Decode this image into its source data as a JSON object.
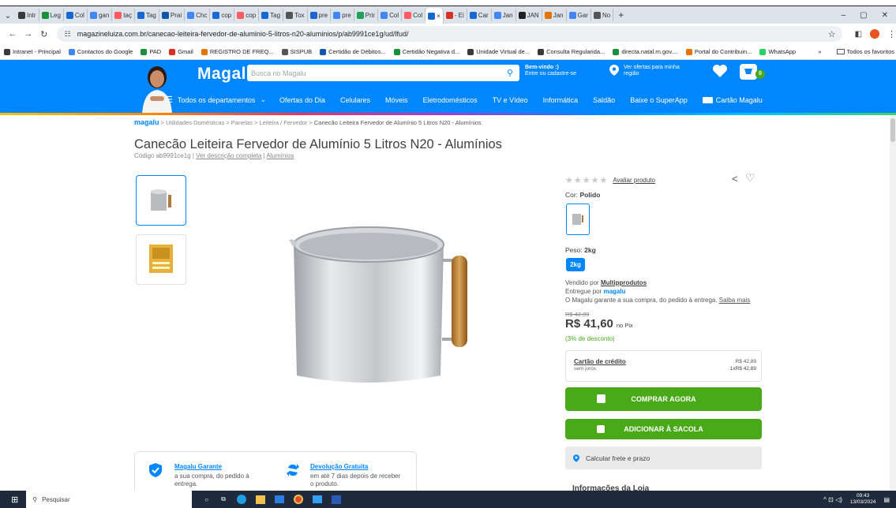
{
  "browser": {
    "tabs": [
      {
        "label": "Intr",
        "color": "#3a3a3a"
      },
      {
        "label": "Leg",
        "color": "#1a8f3c"
      },
      {
        "label": "Col",
        "color": "#1967d2"
      },
      {
        "label": "gan",
        "color": "#4285f4"
      },
      {
        "label": "taç",
        "color": "#ff5a5f"
      },
      {
        "label": "Tag",
        "color": "#1967d2"
      },
      {
        "label": "Prai",
        "color": "#1256a8"
      },
      {
        "label": "Chc",
        "color": "#4285f4"
      },
      {
        "label": "cop",
        "color": "#1967d2"
      },
      {
        "label": "cop",
        "color": "#ff5a5f"
      },
      {
        "label": "Tag",
        "color": "#1967d2"
      },
      {
        "label": "Tox",
        "color": "#555555"
      },
      {
        "label": "pre",
        "color": "#1967d2"
      },
      {
        "label": "pre",
        "color": "#4285f4"
      },
      {
        "label": "Prir",
        "color": "#20a05a"
      },
      {
        "label": "Col",
        "color": "#4285f4"
      },
      {
        "label": "Col",
        "color": "#ff5a5f"
      },
      {
        "label": "×",
        "color": "#1967d2",
        "active": true
      },
      {
        "label": "- Ei",
        "color": "#d93025"
      },
      {
        "label": "Car",
        "color": "#1967d2"
      },
      {
        "label": "Jan",
        "color": "#4285f4"
      },
      {
        "label": "JAN",
        "color": "#222222"
      },
      {
        "label": "Jan",
        "color": "#e37400"
      },
      {
        "label": "Gar",
        "color": "#4285f4"
      },
      {
        "label": "No",
        "color": "#555555"
      }
    ],
    "new_tab": "+",
    "window_controls": {
      "minimize": "–",
      "restore": "▢",
      "close": "✕"
    },
    "url": "magazineluiza.com.br/canecao-leiteira-fervedor-de-aluminio-5-litros-n20-aluminios/p/ab9991ce1g/ud/lfud/",
    "bookmarks": [
      {
        "label": "Intranet - Principal",
        "color": "#3a3a3a"
      },
      {
        "label": "Contactos do Google",
        "color": "#4285f4"
      },
      {
        "label": "PAD",
        "color": "#1a8f3c"
      },
      {
        "label": "Gmail",
        "color": "#d93025"
      },
      {
        "label": "REGISTRO DE FREQ...",
        "color": "#e37400"
      },
      {
        "label": "SISPUB",
        "color": "#555555"
      },
      {
        "label": "Certidão de Débitos...",
        "color": "#1256a8"
      },
      {
        "label": "Certidão Negativa d...",
        "color": "#1a8f3c"
      },
      {
        "label": "Unidade Virtual de...",
        "color": "#3a3a3a"
      },
      {
        "label": "Consulta Regularida...",
        "color": "#3a3a3a"
      },
      {
        "label": "directa.natal.rn.gov....",
        "color": "#1a8f3c"
      },
      {
        "label": "Portal do Contribuin...",
        "color": "#e37400"
      },
      {
        "label": "WhatsApp",
        "color": "#25d366"
      }
    ],
    "bookmarks_more": "»",
    "all_bookmarks": "Todos os favoritos"
  },
  "header": {
    "logo": "Magalu",
    "search_placeholder": "Busca no Magalu",
    "welcome_line1": "Bem-vindo :)",
    "welcome_line2": "Entre ou cadastre-se",
    "offers_line1": "Ver ofertas para minha",
    "offers_line2": "região",
    "cart_count": "0",
    "menu": [
      "Todos os departamentos",
      "Ofertas do Dia",
      "Celulares",
      "Móveis",
      "Eletrodomésticos",
      "TV e Vídeo",
      "Informática",
      "Saldão",
      "Baixe o SuperApp",
      "Cartão Magalu"
    ],
    "accent": "#0086ff"
  },
  "breadcrumb": {
    "logo": "magalu",
    "path": " > Utilidades Domésticas > Panelas > Leiteira / Fervedor > ",
    "current": "Canecão Leiteira Fervedor de Alumínio 5 Litros N20 - Alumínios"
  },
  "product": {
    "title": "Canecão Leiteira Fervedor de Alumínio 5 Litros N20 - Alumínios",
    "code_prefix": "Código ab9991ce1g | ",
    "code_link": "Ver descrição completa",
    "brand": "Alumínios",
    "rating_link": "Avaliar produto",
    "color_label": "Cor:",
    "color_value": "Polido",
    "weight_label": "Peso:",
    "weight_value": "2kg",
    "weight_option": "2kg",
    "sold_by": "Vendido por ",
    "seller": "Multipprodutos",
    "delivered_by": "Entregue por ",
    "delivered_logo": "magalu",
    "guarantee_text": "O Magalu garante a sua compra, do pedido à entrega. ",
    "guarantee_link": "Saiba mais",
    "old_price": "R$ 42,89",
    "price": "R$ 41,60",
    "price_suffix": "no Pix",
    "discount": "(3% de desconto)",
    "card_label": "Cartão de crédito",
    "card_sub": "sem juros",
    "card_price": "R$ 42,89",
    "card_installment": "1xR$ 42,89",
    "buy_now": "COMPRAR AGORA",
    "add_bag": "ADICIONAR À SACOLA",
    "shipping": "Calcular frete e prazo",
    "store_info": "Informações da Loja",
    "green": "#4aa918"
  },
  "guarantees": [
    {
      "title": "Magalu Garante",
      "line1": "a sua compra, do pedido à",
      "line2": "entrega."
    },
    {
      "title": "Devolução Gratuita",
      "line1": "em até 7 dias depois de receber",
      "line2": "o produto."
    }
  ],
  "taskbar": {
    "search": "Pesquisar",
    "time": "09:43",
    "date": "13/03/2024"
  }
}
